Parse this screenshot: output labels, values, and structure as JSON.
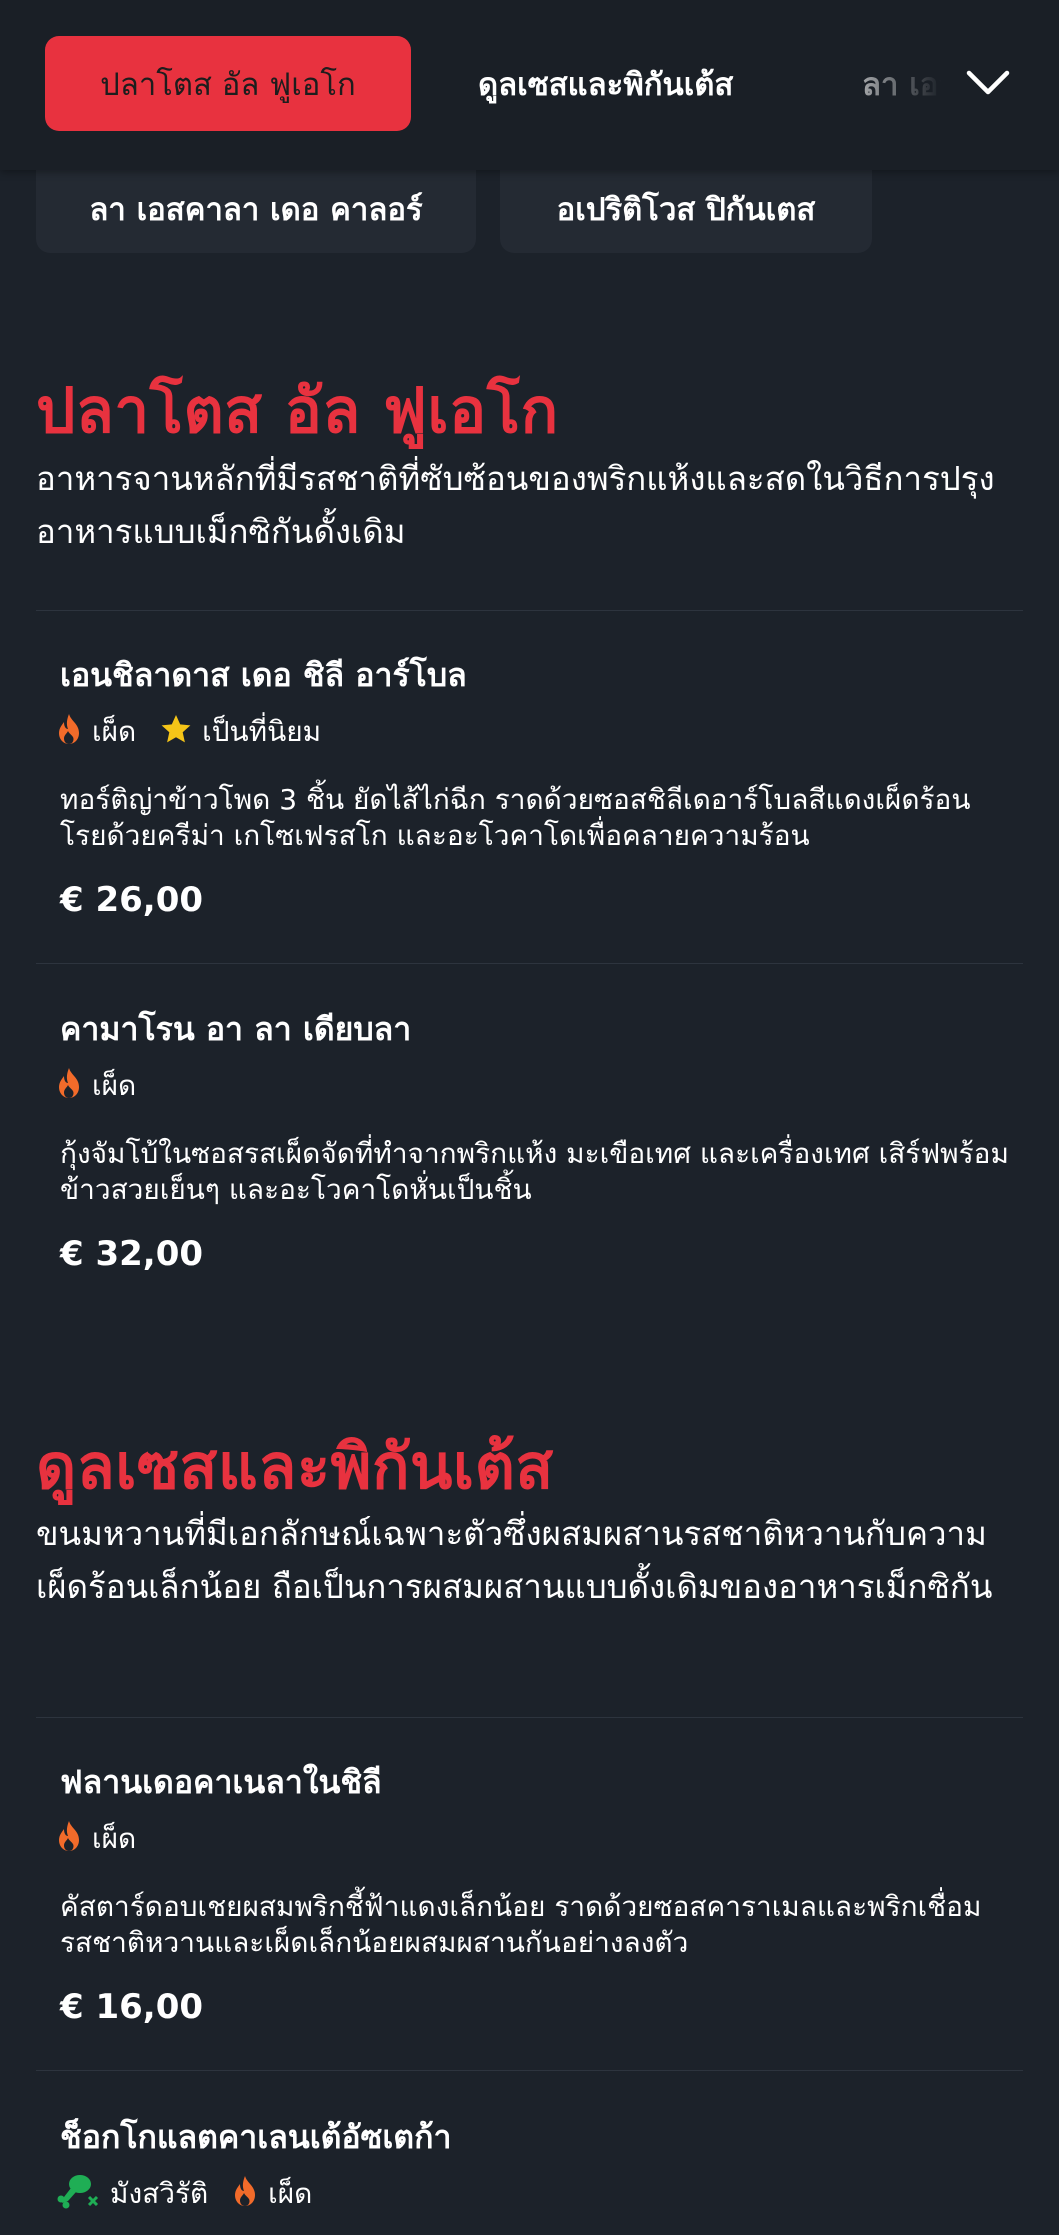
{
  "nav": {
    "active_tab": "ปลาโตส อัล ฟูเอโก",
    "tab_2": "ดูลเซสและพิกันเต้ส",
    "tab_3_partial": "ลา เอสคาลา",
    "pill_1": "ลา เอสคาลา เดอ คาลอร์",
    "pill_2": "อเปริติโวส ปิกันเตส"
  },
  "sections": [
    {
      "title": "ปลาโตส อัล ฟูเอโก",
      "description": "อาหารจานหลักที่มีรสชาติที่ซับซ้อนของพริกแห้งและสดในวิธีการปรุงอาหารแบบเม็กซิกันดั้งเดิม",
      "items": [
        {
          "name": "เอนชิลาดาส เดอ ชิลี อาร์โบล",
          "tags": [
            "เผ็ด",
            "เป็นที่นิยม"
          ],
          "description": "ทอร์ติญ่าข้าวโพด 3 ชิ้น ยัดไส้ไก่ฉีก ราดด้วยซอสชิลีเดอาร์โบลสีแดงเผ็ดร้อน โรยด้วยครีม่า เกโซเฟรสโก และอะโวคาโดเพื่อคลายความร้อน",
          "price": "€ 26,00"
        },
        {
          "name": "คามาโรน อา ลา เดียบลา",
          "tags": [
            "เผ็ด"
          ],
          "description": "กุ้งจัมโบ้ในซอสรสเผ็ดจัดที่ทำจากพริกแห้ง มะเขือเทศ และเครื่องเทศ เสิร์ฟพร้อมข้าวสวยเย็นๆ และอะโวคาโดหั่นเป็นชิ้น",
          "price": "€ 32,00"
        }
      ]
    },
    {
      "title": "ดูลเซสและพิกันเต้ส",
      "description": "ขนมหวานที่มีเอกลักษณ์เฉพาะตัวซึ่งผสมผสานรสชาติหวานกับความเผ็ดร้อนเล็กน้อย ถือเป็นการผสมผสานแบบดั้งเดิมของอาหารเม็กซิกัน",
      "items": [
        {
          "name": "ฟลานเดอคาเนลาในชิลี",
          "tags": [
            "เผ็ด"
          ],
          "description": "คัสตาร์ดอบเชยผสมพริกชี้ฟ้าแดงเล็กน้อย ราดด้วยซอสคาราเมลและพริกเชื่อมรสชาติหวานและเผ็ดเล็กน้อยผสมผสานกันอย่างลงตัว",
          "price": "€ 16,00"
        },
        {
          "name": "ช็อกโกแลตคาเลนเต้อัซเตก้า",
          "tags": [
            "มังสวิรัติ",
            "เผ็ด"
          ]
        }
      ]
    }
  ],
  "colors": {
    "accent": "#e8323f",
    "background": "#1c222a",
    "flame": "#f26b2a",
    "star": "#f5c518",
    "vegan": "#1fae55"
  }
}
